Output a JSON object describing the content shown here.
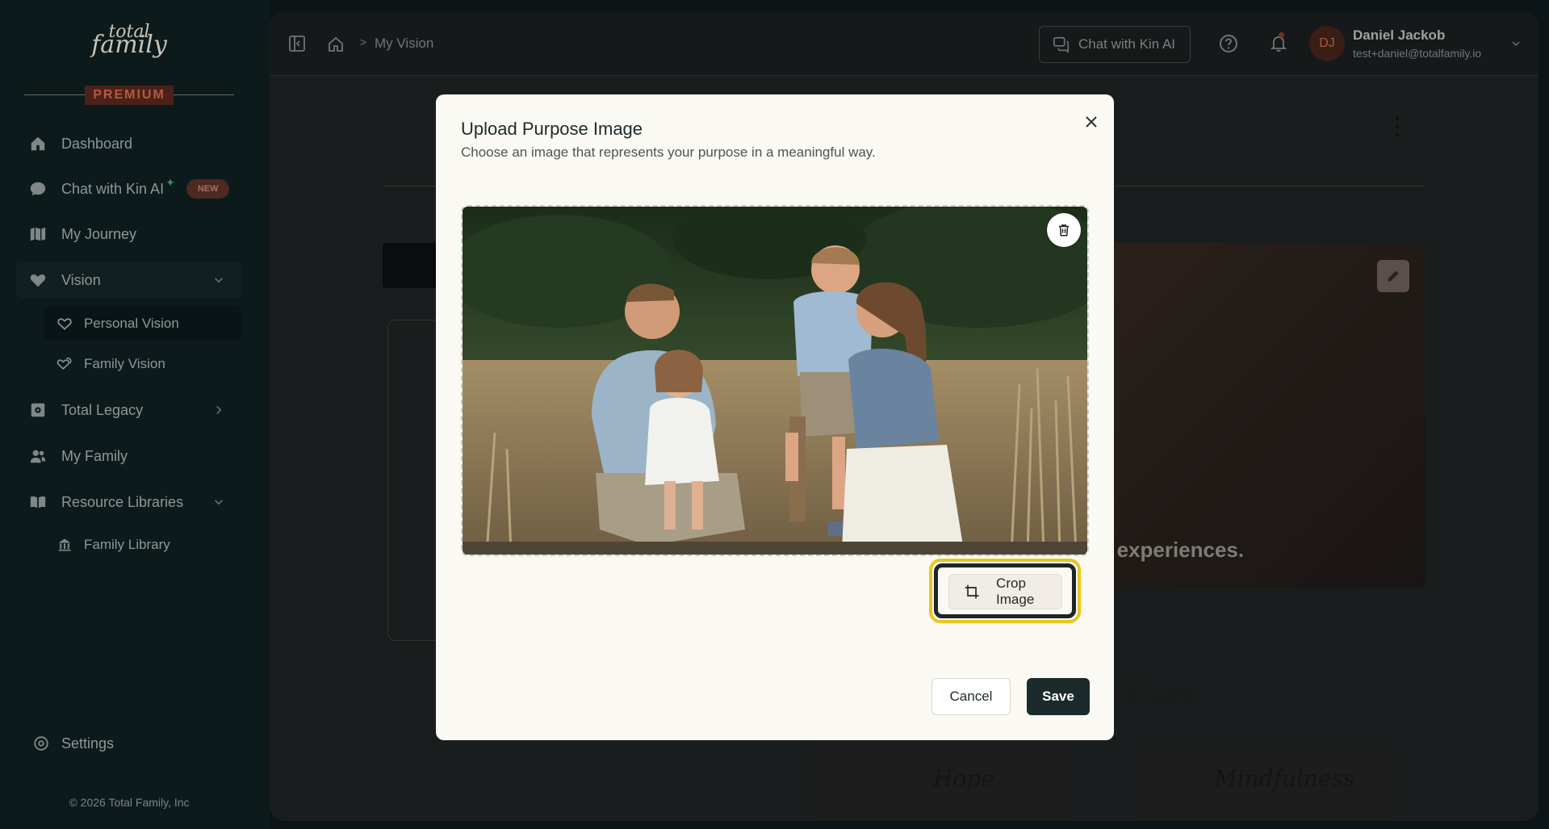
{
  "brand": {
    "logo_line1": "total",
    "logo_line2": "family",
    "tier_badge": "PREMIUM"
  },
  "sidebar": {
    "items": [
      {
        "label": "Dashboard",
        "icon": "home-icon"
      },
      {
        "label": "Chat with Kin AI",
        "icon": "chat-bubble-icon",
        "badge": "NEW"
      },
      {
        "label": "My Journey",
        "icon": "map-icon"
      },
      {
        "label": "Vision",
        "icon": "heart-icon",
        "expanded": true
      },
      {
        "label": "Total Legacy",
        "icon": "vault-icon"
      },
      {
        "label": "My Family",
        "icon": "users-icon"
      },
      {
        "label": "Resource Libraries",
        "icon": "book-icon",
        "expanded": true
      }
    ],
    "vision_children": [
      {
        "label": "Personal Vision",
        "icon": "heart-outline-icon",
        "active": true
      },
      {
        "label": "Family Vision",
        "icon": "hearts-icon"
      }
    ],
    "resource_children": [
      {
        "label": "Family Library",
        "icon": "library-icon"
      }
    ],
    "settings_label": "Settings",
    "copyright": "© 2026 Total Family, Inc"
  },
  "topbar": {
    "breadcrumb_current": "My Vision",
    "breadcrumb_separator": ">",
    "chat_button_label": "Chat with Kin AI",
    "user_initials": "DJ",
    "user_name": "Daniel Jackob",
    "user_email": "test+daniel@totalfamily.io"
  },
  "background": {
    "photo_caption": "ed experiences.",
    "values_heading": "Values",
    "value_words": [
      "Hope",
      "Mindfulness"
    ]
  },
  "modal": {
    "title": "Upload Purpose Image",
    "subtitle": "Choose an image that represents your purpose in a meaningful way.",
    "crop_button_label": "Crop Image",
    "cancel_label": "Cancel",
    "save_label": "Save"
  },
  "colors": {
    "highlight_ring": "#e9c61d",
    "save_button": "#1b2a2b",
    "modal_background": "#fbf9f3",
    "premium_badge": "#4b2219"
  }
}
